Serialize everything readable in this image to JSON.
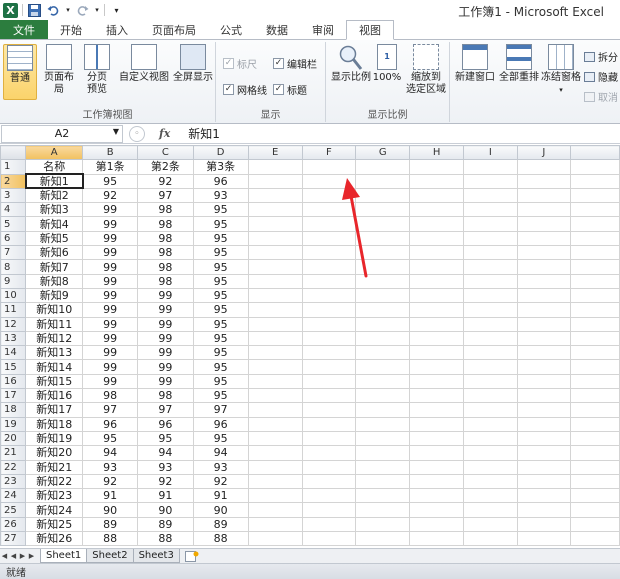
{
  "window": {
    "title": "工作簿1 - Microsoft Excel"
  },
  "qat": {
    "icons": [
      "excel-logo",
      "save-icon",
      "undo-icon",
      "redo-icon",
      "customize-icon"
    ],
    "logo_text": "X"
  },
  "ribbon_tabs": [
    "文件",
    "开始",
    "插入",
    "页面布局",
    "公式",
    "数据",
    "审阅",
    "视图"
  ],
  "ribbon": {
    "workbook_views": {
      "label": "工作簿视图",
      "normal": "普通",
      "page_layout": "页面布局",
      "page_break_1": "分页",
      "page_break_2": "预览",
      "custom_views": "自定义视图",
      "full_screen": "全屏显示"
    },
    "show": {
      "label": "显示",
      "ruler": "标尺",
      "formula_bar": "编辑栏",
      "gridlines": "网格线",
      "headings": "标题",
      "ruler_checked": true,
      "formula_bar_checked": true,
      "gridlines_checked": true,
      "headings_checked": true
    },
    "zoom": {
      "label": "显示比例",
      "zoom": "显示比例",
      "zoom_100": "100%",
      "zoom_sel_1": "缩放到",
      "zoom_sel_2": "选定区域"
    },
    "window": {
      "new_window": "新建窗口",
      "arrange_all": "全部重排",
      "freeze_panes": "冻结窗格",
      "split": "拆分",
      "hide": "隐藏",
      "unhide": "取消"
    }
  },
  "formula_bar": {
    "name_box": "A2",
    "fx": "fx",
    "content": "新知1"
  },
  "grid": {
    "columns": [
      "A",
      "B",
      "C",
      "D",
      "E",
      "F",
      "G",
      "H",
      "I",
      "J"
    ],
    "headers": [
      "名称",
      "第1条",
      "第2条",
      "第3条"
    ],
    "rows": [
      [
        "新知1",
        "95",
        "92",
        "96"
      ],
      [
        "新知2",
        "92",
        "97",
        "93"
      ],
      [
        "新知3",
        "99",
        "98",
        "95"
      ],
      [
        "新知4",
        "99",
        "98",
        "95"
      ],
      [
        "新知5",
        "99",
        "98",
        "95"
      ],
      [
        "新知6",
        "99",
        "98",
        "95"
      ],
      [
        "新知7",
        "99",
        "98",
        "95"
      ],
      [
        "新知8",
        "99",
        "98",
        "95"
      ],
      [
        "新知9",
        "99",
        "99",
        "95"
      ],
      [
        "新知10",
        "99",
        "99",
        "95"
      ],
      [
        "新知11",
        "99",
        "99",
        "95"
      ],
      [
        "新知12",
        "99",
        "99",
        "95"
      ],
      [
        "新知13",
        "99",
        "99",
        "95"
      ],
      [
        "新知14",
        "99",
        "99",
        "95"
      ],
      [
        "新知15",
        "99",
        "99",
        "95"
      ],
      [
        "新知16",
        "98",
        "98",
        "95"
      ],
      [
        "新知17",
        "97",
        "97",
        "97"
      ],
      [
        "新知18",
        "96",
        "96",
        "96"
      ],
      [
        "新知19",
        "95",
        "95",
        "95"
      ],
      [
        "新知20",
        "94",
        "94",
        "94"
      ],
      [
        "新知21",
        "93",
        "93",
        "93"
      ],
      [
        "新知22",
        "92",
        "92",
        "92"
      ],
      [
        "新知23",
        "91",
        "91",
        "91"
      ],
      [
        "新知24",
        "90",
        "90",
        "90"
      ],
      [
        "新知25",
        "89",
        "89",
        "89"
      ],
      [
        "新知26",
        "88",
        "88",
        "88"
      ]
    ],
    "active_cell": "A2",
    "colors": {
      "header_selected": "#f1c15f",
      "gridline": "#d4d4d4",
      "annotation_arrow": "#e8262b"
    }
  },
  "sheet_tabs": [
    "Sheet1",
    "Sheet2",
    "Sheet3"
  ],
  "status": {
    "text": "就绪"
  }
}
